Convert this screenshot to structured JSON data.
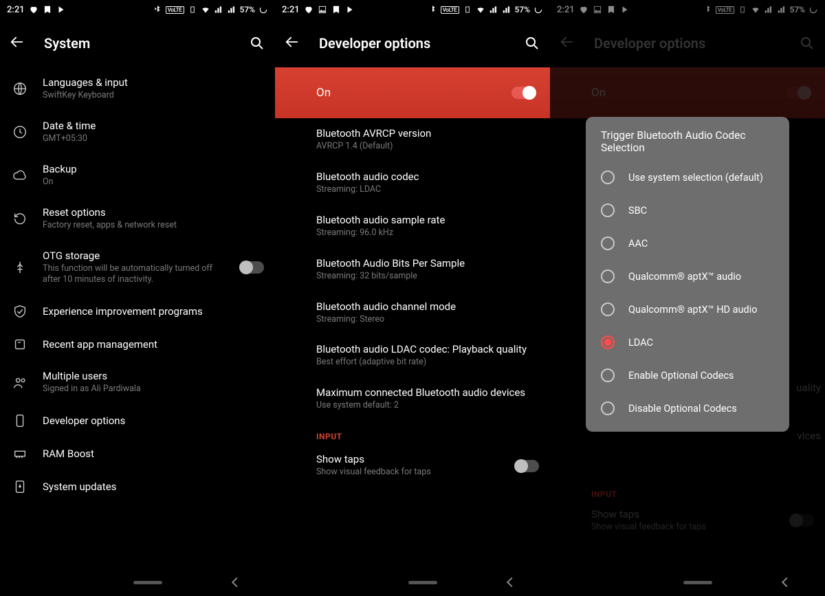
{
  "status": {
    "time": "2:21",
    "battery": "57%"
  },
  "p1": {
    "title": "System",
    "items": [
      {
        "label": "Languages & input",
        "sub": "SwiftKey Keyboard"
      },
      {
        "label": "Date & time",
        "sub": "GMT+05:30"
      },
      {
        "label": "Backup",
        "sub": "On"
      },
      {
        "label": "Reset options",
        "sub": "Factory reset, apps & network reset"
      },
      {
        "label": "OTG storage",
        "sub": "This function will be automatically turned off after 10 minutes of inactivity."
      },
      {
        "label": "Experience improvement programs",
        "sub": ""
      },
      {
        "label": "Recent app management",
        "sub": ""
      },
      {
        "label": "Multiple users",
        "sub": "Signed in as Ali Pardiwala"
      },
      {
        "label": "Developer options",
        "sub": ""
      },
      {
        "label": "RAM Boost",
        "sub": ""
      },
      {
        "label": "System updates",
        "sub": ""
      }
    ]
  },
  "p2": {
    "title": "Developer options",
    "master": "On",
    "items": [
      {
        "label": "Bluetooth AVRCP version",
        "sub": "AVRCP 1.4 (Default)"
      },
      {
        "label": "Bluetooth audio codec",
        "sub": "Streaming: LDAC"
      },
      {
        "label": "Bluetooth audio sample rate",
        "sub": "Streaming: 96.0 kHz"
      },
      {
        "label": "Bluetooth Audio Bits Per Sample",
        "sub": "Streaming: 32 bits/sample"
      },
      {
        "label": "Bluetooth audio channel mode",
        "sub": "Streaming: Stereo"
      },
      {
        "label": "Bluetooth audio LDAC codec: Playback quality",
        "sub": "Best effort (adaptive bit rate)"
      },
      {
        "label": "Maximum connected Bluetooth audio devices",
        "sub": "Use system default: 2"
      }
    ],
    "section_input": "INPUT",
    "show_taps": {
      "label": "Show taps",
      "sub": "Show visual feedback for taps"
    }
  },
  "p3": {
    "title": "Developer options",
    "master": "On",
    "section_input": "INPUT",
    "show_taps": {
      "label": "Show taps",
      "sub": "Show visual feedback for taps"
    },
    "dialog_title": "Trigger Bluetooth Audio Codec Selection",
    "dialog_options": [
      "Use system selection (default)",
      "SBC",
      "AAC",
      "Qualcomm® aptX™ audio",
      "Qualcomm® aptX™ HD audio",
      "LDAC",
      "Enable Optional Codecs",
      "Disable Optional Codecs"
    ],
    "dialog_selected": 5,
    "peek_right_1": "uality",
    "peek_right_2": "vices"
  }
}
